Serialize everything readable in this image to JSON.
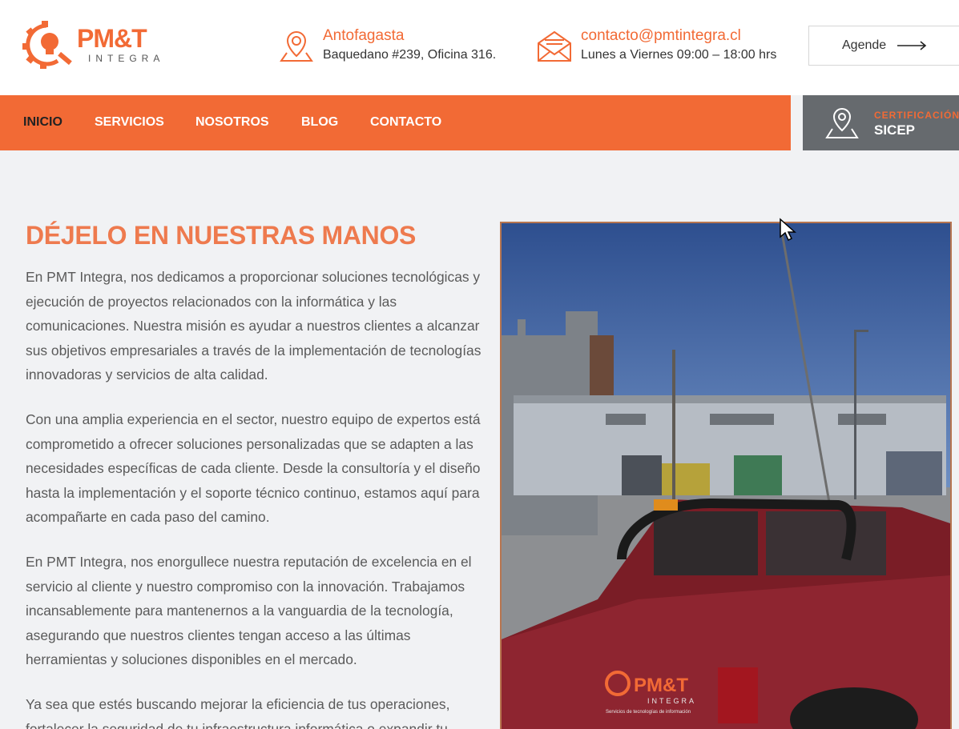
{
  "header": {
    "logo": {
      "brand": "PM&T",
      "sub": "INTEGRA"
    },
    "location": {
      "city": "Antofagasta",
      "address": "Baquedano #239, Oficina 316."
    },
    "contact": {
      "email": "contacto@pmtintegra.cl",
      "hours": "Lunes a Viernes 09:00 – 18:00 hrs"
    },
    "agende_label": "Agende"
  },
  "nav": {
    "items": [
      {
        "label": "INICIO",
        "active": true
      },
      {
        "label": "SERVICIOS"
      },
      {
        "label": "NOSOTROS"
      },
      {
        "label": "BLOG"
      },
      {
        "label": "CONTACTO"
      }
    ]
  },
  "certification": {
    "line1": "CERTIFICACIÓN",
    "line2": "SICEP"
  },
  "main": {
    "heading": "DÉJELO EN NUESTRAS MANOS",
    "paragraphs": [
      "En PMT Integra, nos dedicamos a proporcionar soluciones tecnológicas y ejecución de proyectos relacionados con la informática y las comunicaciones. Nuestra misión es ayudar a nuestros clientes a alcanzar sus objetivos empresariales a través de la implementación de tecnologías innovadoras y servicios de alta calidad.",
      "Con una amplia experiencia en el sector, nuestro equipo de expertos está comprometido a ofrecer soluciones personalizadas que se adapten a las necesidades específicas de cada cliente. Desde la consultoría y el diseño hasta la implementación y el soporte técnico continuo, estamos aquí para acompañarte en cada paso del camino.",
      "En PMT Integra, nos enorgullece nuestra reputación de excelencia en el servicio al cliente y nuestro compromiso con la innovación. Trabajamos incansablemente para mantenernos a la vanguardia de la tecnología, asegurando que nuestros clientes tengan acceso a las últimas herramientas y soluciones disponibles en el mercado.",
      "Ya sea que estés buscando mejorar la eficiencia de tus operaciones, fortalecer la seguridad de tu infraestructura informática o expandir tu"
    ],
    "photo": {
      "truck_brand": "PM&T",
      "truck_sub": "INTEGRA",
      "truck_tagline": "Servicios de tecnologías de información"
    }
  },
  "colors": {
    "brand_orange": "#f26a35",
    "heading_orange": "#ee7a4e",
    "cert_gray": "#666a6e",
    "background": "#f1f2f4"
  },
  "icons": [
    "gear-lightbulb-logo-icon",
    "map-pin-icon",
    "envelope-icon",
    "arrow-right-icon",
    "map-location-icon",
    "mouse-cursor-icon"
  ]
}
